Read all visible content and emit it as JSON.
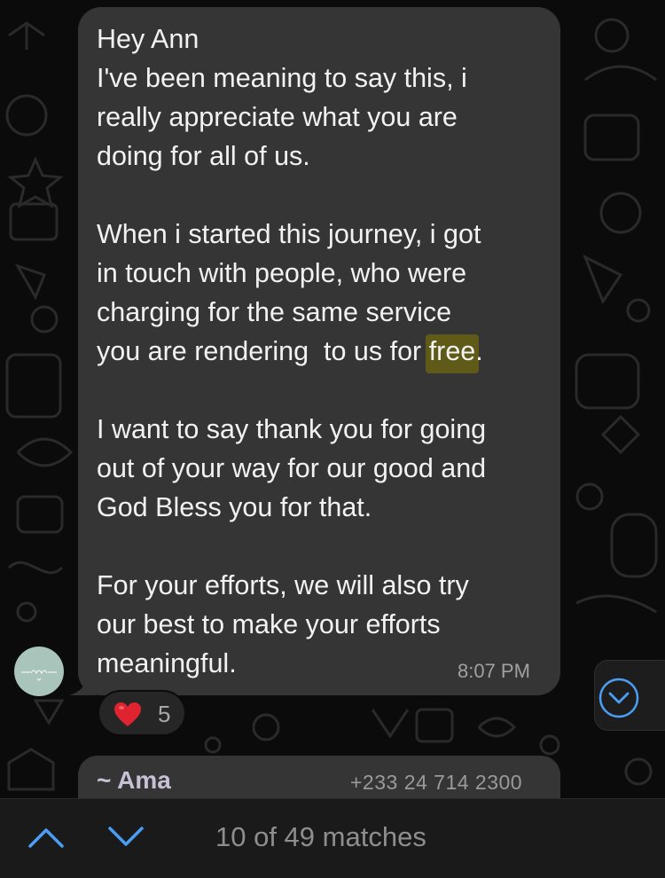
{
  "message": {
    "lines_block1": [
      "Hey Ann",
      "I've been meaning to say this, i",
      "really appreciate what you are",
      "doing for all of us."
    ],
    "lines_block2": [
      "When i started this journey, i got",
      "in touch with people, who were",
      "charging for the same service"
    ],
    "line_with_highlight_prefix": "you are rendering  to us for ",
    "highlight_word": "free",
    "line_with_highlight_suffix": ".",
    "lines_block3": [
      "I want to say thank you for going",
      "out of your way for our good and",
      "God Bless you for that."
    ],
    "lines_block4": [
      "For your efforts, we will also try",
      "our best to make your efforts",
      "meaningful."
    ],
    "timestamp": "8:07 PM"
  },
  "reaction": {
    "emoji_name": "red-heart",
    "count": "5"
  },
  "next_message": {
    "sender": "~ Ama",
    "phone": "+233 24 714 2300"
  },
  "search_bar": {
    "matches_text": "10 of 49 matches",
    "up_icon": "chevron-up-icon",
    "down_icon": "chevron-down-icon"
  },
  "colors": {
    "bubble": "#353535",
    "highlight": "#5f5a18",
    "accent": "#4a9ff5"
  }
}
